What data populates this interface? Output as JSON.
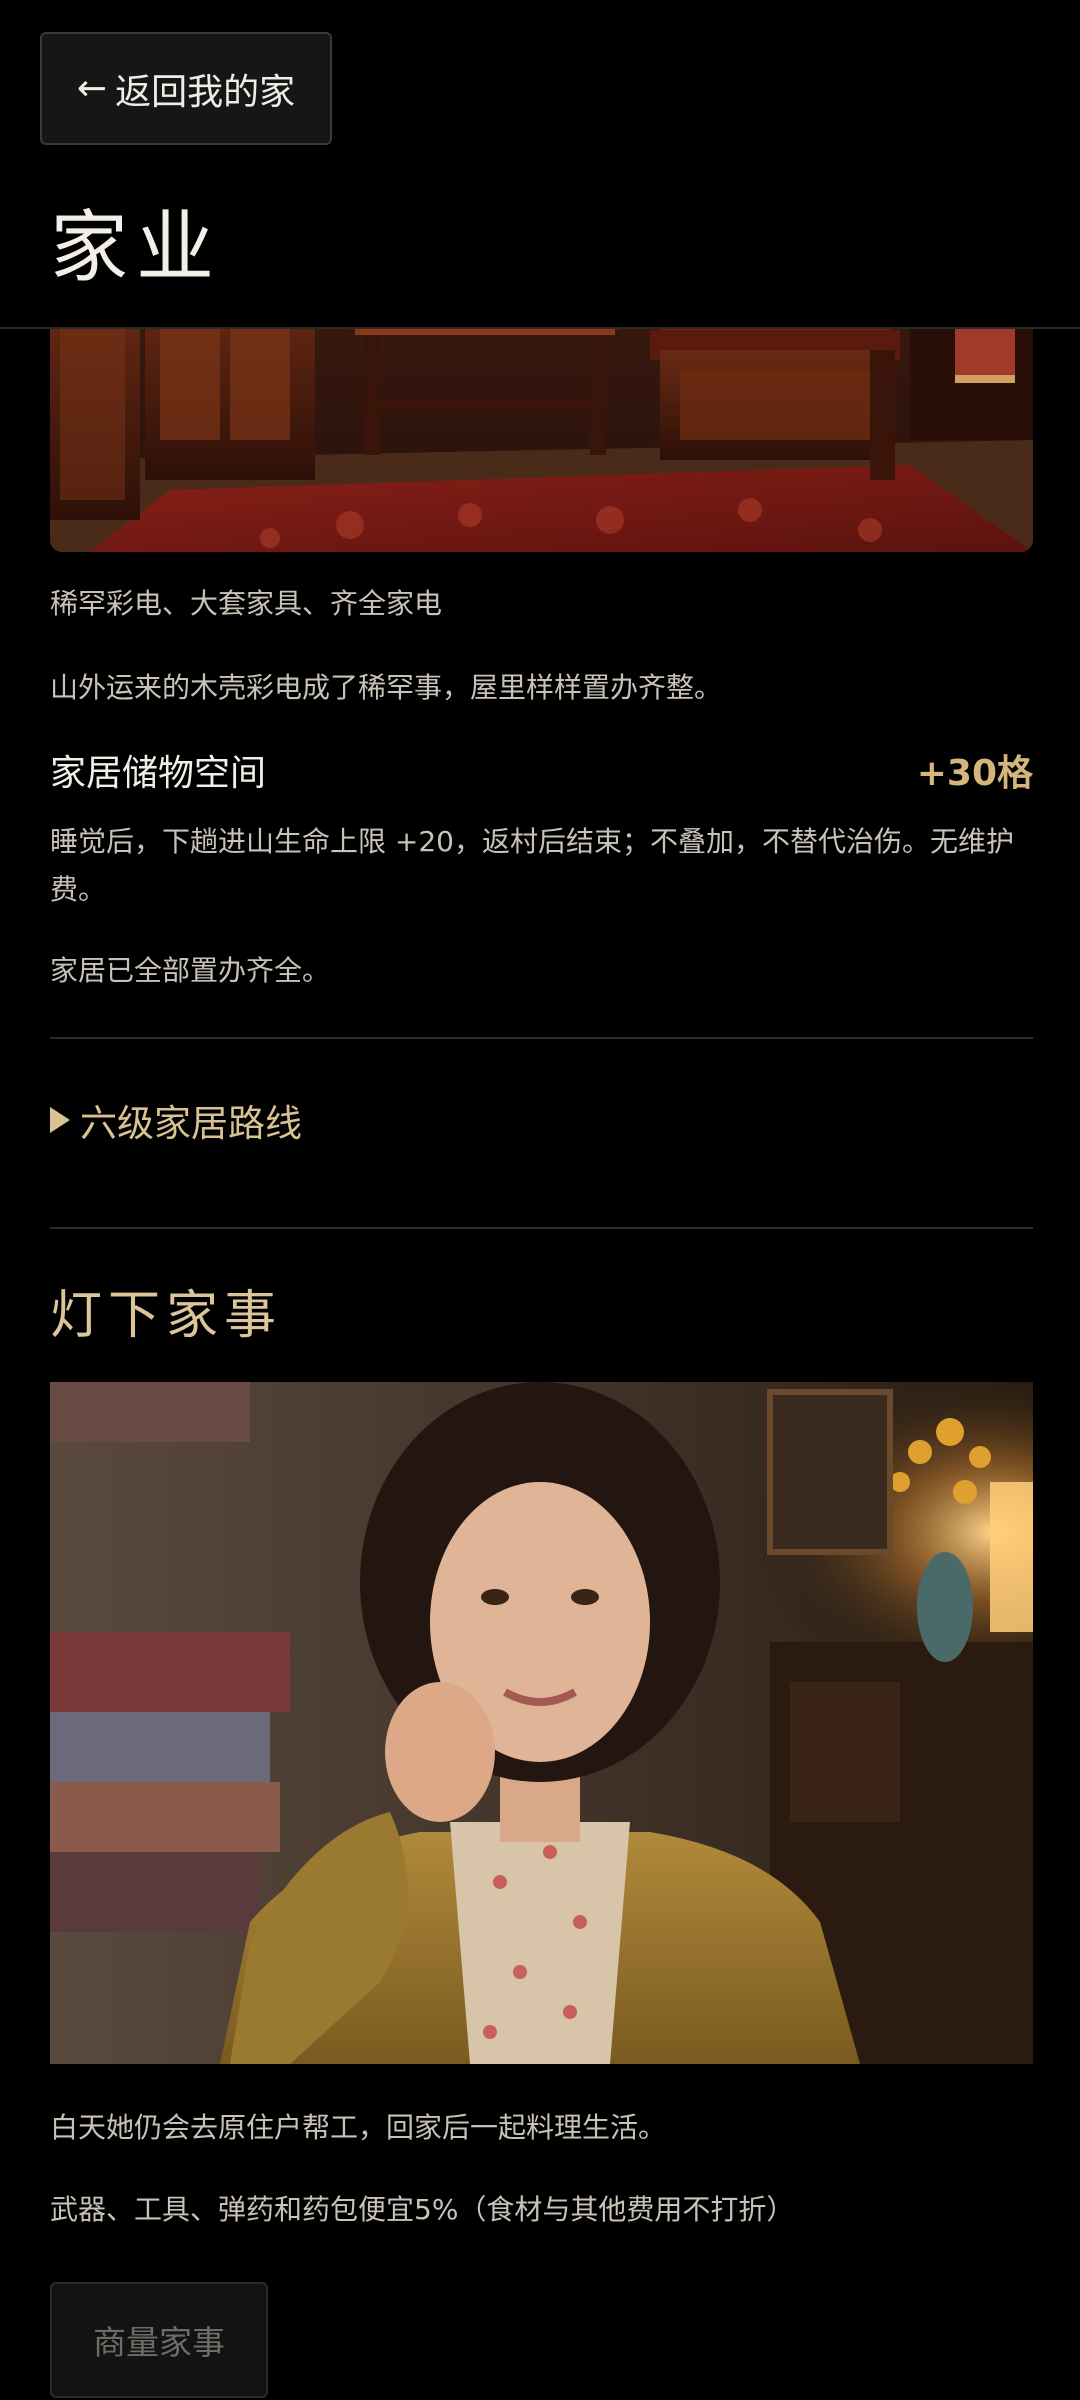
{
  "header": {
    "back_arrow": "←",
    "back_label": "返回我的家",
    "title": "家业"
  },
  "home_tier": {
    "image": "living-room-image",
    "caption": "稀罕彩电、大套家具、齐全家电",
    "description": "山外运来的木壳彩电成了稀罕事，屋里样样置办齐整。",
    "storage_label": "家居储物空间",
    "storage_value": "+30格",
    "effect": "睡觉后，下趟进山生命上限 +20，返村后结束；不叠加，不替代治伤。无维护费。",
    "status": "家居已全部置办齐全。"
  },
  "route_toggle": {
    "icon": "triangle-right-icon",
    "label": "六级家居路线"
  },
  "evening_section": {
    "title": "灯下家事",
    "image": "wife-portrait-image",
    "description": "白天她仍会去原住户帮工，回家后一起料理生活。",
    "discount": "武器、工具、弹药和药包便宜5%（食材与其他费用不打折）",
    "button_label": "商量家事"
  },
  "colors": {
    "background": "#000000",
    "accent_gold": "#d3b57d",
    "text_primary": "#f3efe8",
    "text_secondary": "#c8c2b8"
  }
}
